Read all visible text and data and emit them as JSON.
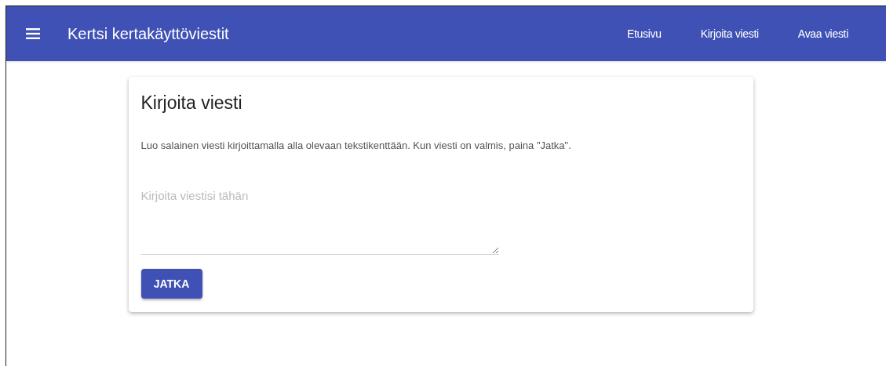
{
  "app_bar": {
    "title": "Kertsi kertakäyttöviestit",
    "nav_links": [
      {
        "label": "Etusivu"
      },
      {
        "label": "Kirjoita viesti"
      },
      {
        "label": "Avaa viesti"
      }
    ]
  },
  "card": {
    "title": "Kirjoita viesti",
    "description": "Luo salainen viesti kirjoittamalla alla olevaan tekstikenttään. Kun viesti on valmis, paina \"Jatka\".",
    "message_field": {
      "placeholder": "Kirjoita viestisi tähän"
    },
    "button": "JATKA"
  }
}
